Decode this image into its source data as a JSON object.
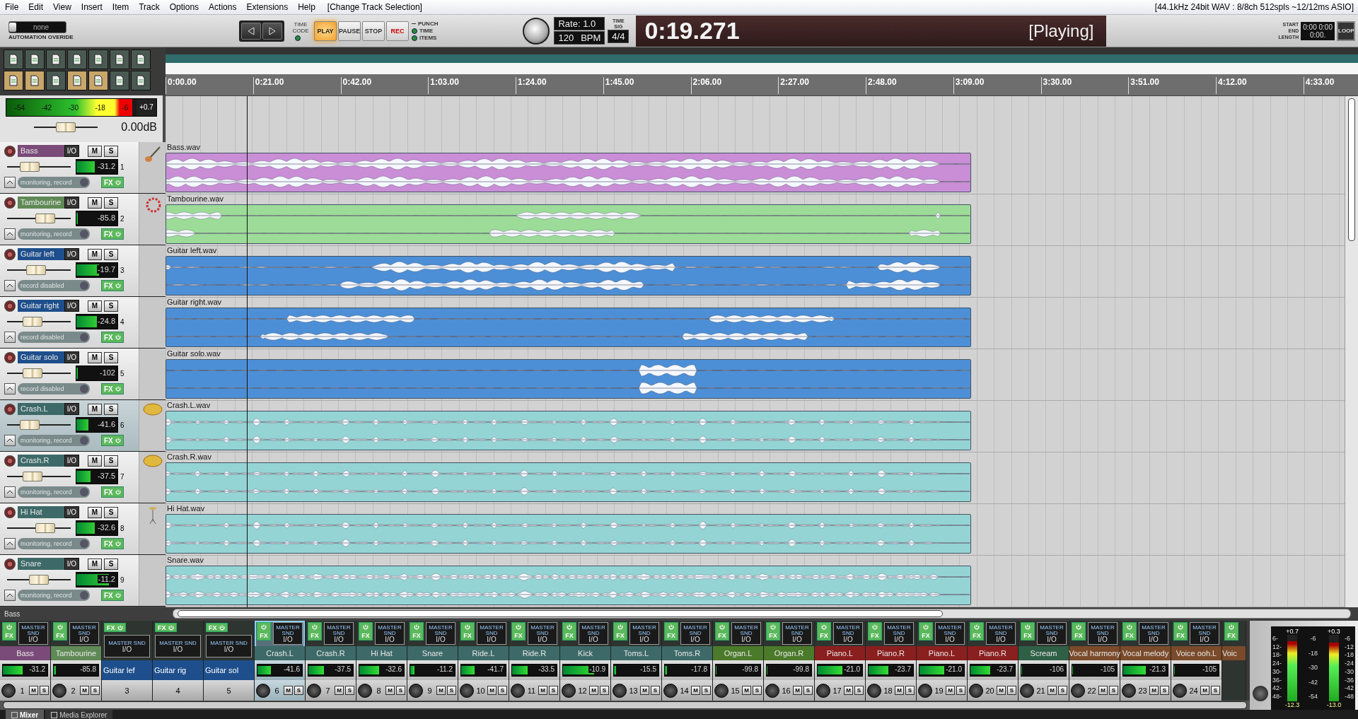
{
  "menu": [
    "File",
    "Edit",
    "View",
    "Insert",
    "Item",
    "Track",
    "Options",
    "Actions",
    "Extensions",
    "Help"
  ],
  "action_hint": "[Change Track Selection]",
  "audio_status": "[44.1kHz 24bit WAV : 8/8ch 512spls ~12/12ms ASIO]",
  "automation_override": {
    "value": "none",
    "label": "AUTOMATION OVERIDE"
  },
  "transport": {
    "time_code": "TIME CODE",
    "buttons": [
      {
        "label": "PLAY",
        "kind": "play",
        "selected": true
      },
      {
        "label": "PAUSE",
        "kind": "pause",
        "selected": false
      },
      {
        "label": "STOP",
        "kind": "stop",
        "selected": false
      },
      {
        "label": "REC",
        "kind": "record",
        "selected": false
      }
    ],
    "options": [
      {
        "label": "PUNCH",
        "kind": "bracket"
      },
      {
        "label": "TIME",
        "kind": "led"
      },
      {
        "label": "ITEMS",
        "kind": "led"
      }
    ]
  },
  "rate": "Rate: 1.0",
  "bpm": {
    "value": "120",
    "unit": "BPM"
  },
  "time_signature": {
    "label": "TIME SIG",
    "value": "4/4"
  },
  "clock": {
    "time": "0:19.271",
    "state": "[Playing]"
  },
  "loop": {
    "labels": [
      "START",
      "END",
      "LENGTH"
    ],
    "start": "0:00",
    "end": "0:00",
    "length": "0:00.",
    "button": "LOOP"
  },
  "toolbar": [
    {
      "on": false
    },
    {
      "on": false
    },
    {
      "on": false
    },
    {
      "on": false
    },
    {
      "on": false
    },
    {
      "on": false
    },
    {
      "on": false
    },
    {
      "on": true
    },
    {
      "on": true
    },
    {
      "on": false
    },
    {
      "on": true
    },
    {
      "on": true
    },
    {
      "on": false
    },
    {
      "on": false
    }
  ],
  "master_track": {
    "meter_scale": [
      "-54",
      "-42",
      "-30",
      "-18",
      "-6"
    ],
    "peak": "+0.7",
    "meter": {
      "level": 0.97
    },
    "fader": {
      "level": 0.5
    },
    "volume": "0.00dB"
  },
  "ruler": [
    "0:00.00",
    "0:21.00",
    "0:42.00",
    "1:03.00",
    "1:24.00",
    "1:45.00",
    "2:06.00",
    "2:27.00",
    "2:48.00",
    "3:09.00",
    "3:30.00",
    "3:51.00",
    "4:12.00",
    "4:33.00"
  ],
  "playhead": {
    "level": 0.068
  },
  "tracks": [
    {
      "name": "Bass",
      "color": "#7a4a78",
      "number": "1",
      "selected": false,
      "kind": "guitar",
      "io": "I/O",
      "mute": "M",
      "solo": "S",
      "fx": "FX",
      "fader": {
        "level": 0.35
      },
      "meter": {
        "level": 0.45,
        "reading": "-31.2"
      },
      "monitor": "monitoring, record",
      "item": {
        "file": "Bass.wav",
        "color": "#c98ed6"
      }
    },
    {
      "name": "Tambourine",
      "color": "#5f8a55",
      "number": "2",
      "selected": false,
      "kind": "tambourine",
      "io": "I/O",
      "mute": "M",
      "solo": "S",
      "fx": "FX",
      "fader": {
        "level": 0.6
      },
      "meter": {
        "level": 0.04,
        "reading": "-85.8"
      },
      "monitor": "monitoring, record",
      "item": {
        "file": "Tambourine.wav",
        "color": "#9cdc98"
      }
    },
    {
      "name": "Guitar left",
      "color": "#1e4f8c",
      "number": "3",
      "selected": false,
      "kind": "none",
      "io": "I/O",
      "mute": "M",
      "solo": "S",
      "fx": "FX",
      "fader": {
        "level": 0.45
      },
      "meter": {
        "level": 0.55,
        "reading": "-19.7"
      },
      "monitor": "record disabled",
      "item": {
        "file": "Guitar left.wav",
        "color": "#4d8fd6"
      }
    },
    {
      "name": "Guitar right",
      "color": "#1e4f8c",
      "number": "4",
      "selected": false,
      "kind": "none",
      "io": "I/O",
      "mute": "M",
      "solo": "S",
      "fx": "FX",
      "fader": {
        "level": 0.4
      },
      "meter": {
        "level": 0.5,
        "reading": "-24.8"
      },
      "monitor": "record disabled",
      "item": {
        "file": "Guitar right.wav",
        "color": "#4d8fd6"
      }
    },
    {
      "name": "Guitar solo",
      "color": "#1e4f8c",
      "number": "5",
      "selected": false,
      "kind": "none",
      "io": "I/O",
      "mute": "M",
      "solo": "S",
      "fx": "FX",
      "fader": {
        "level": 0.4
      },
      "meter": {
        "level": 0.03,
        "reading": "-102"
      },
      "monitor": "record disabled",
      "item": {
        "file": "Guitar solo.wav",
        "color": "#4d8fd6"
      }
    },
    {
      "name": "Crash.L",
      "color": "#3d6a68",
      "number": "6",
      "selected": true,
      "kind": "cymbal",
      "io": "I/O",
      "mute": "M",
      "solo": "S",
      "fx": "FX",
      "fader": {
        "level": 0.35
      },
      "meter": {
        "level": 0.3,
        "reading": "-41.6"
      },
      "monitor": "monitoring, record",
      "item": {
        "file": "Crash.L.wav",
        "color": "#95d4d4"
      }
    },
    {
      "name": "Crash.R",
      "color": "#3d6a68",
      "number": "7",
      "selected": false,
      "kind": "cymbal",
      "io": "I/O",
      "mute": "M",
      "solo": "S",
      "fx": "FX",
      "fader": {
        "level": 0.4
      },
      "meter": {
        "level": 0.35,
        "reading": "-37.5"
      },
      "monitor": "monitoring, record",
      "item": {
        "file": "Crash.R.wav",
        "color": "#95d4d4"
      }
    },
    {
      "name": "Hi Hat",
      "color": "#3d6a68",
      "number": "8",
      "selected": false,
      "kind": "hihat",
      "io": "I/O",
      "mute": "M",
      "solo": "S",
      "fx": "FX",
      "fader": {
        "level": 0.6
      },
      "meter": {
        "level": 0.45,
        "reading": "-32.6"
      },
      "monitor": "monitoring, record",
      "item": {
        "file": "Hi Hat.wav",
        "color": "#95d4d4"
      }
    },
    {
      "name": "Snare",
      "color": "#3d6a68",
      "number": "9",
      "selected": false,
      "kind": "none",
      "io": "I/O",
      "mute": "M",
      "solo": "S",
      "fx": "FX",
      "fader": {
        "level": 0.5
      },
      "meter": {
        "level": 0.8,
        "reading": "-11.2"
      },
      "monitor": "monitoring, record",
      "item": {
        "file": "Snare.wav",
        "color": "#95d4d4"
      }
    }
  ],
  "status": "Bass",
  "mixer": [
    {
      "kind": "normal",
      "name": "Bass",
      "color": "#7a4a78",
      "number": "1",
      "reading": "-31.2",
      "level": 0.45,
      "selected": false,
      "fx": "FX",
      "send": "MASTER SND",
      "io": "I/O",
      "mute": "M",
      "solo": "S"
    },
    {
      "kind": "normal",
      "name": "Tambourine",
      "color": "#5f8a55",
      "number": "2",
      "reading": "-85.8",
      "level": 0.04,
      "selected": false,
      "fx": "FX",
      "send": "MASTER SND",
      "io": "I/O",
      "mute": "M",
      "solo": "S"
    },
    {
      "kind": "compact",
      "name": "Guitar lef",
      "color": "#1e4f8c",
      "number": "3",
      "selected": false,
      "fx": "FX",
      "send": "MASTER SND",
      "io": "I/O"
    },
    {
      "kind": "compact",
      "name": "Guitar rig",
      "color": "#1e4f8c",
      "number": "4",
      "selected": false,
      "fx": "FX",
      "send": "MASTER SND",
      "io": "I/O"
    },
    {
      "kind": "compact",
      "name": "Guitar sol",
      "color": "#1e4f8c",
      "number": "5",
      "selected": false,
      "fx": "FX",
      "send": "MASTER SND",
      "io": "I/O"
    },
    {
      "kind": "normal",
      "name": "Crash.L",
      "color": "#3d6a68",
      "number": "6",
      "reading": "-41.6",
      "level": 0.3,
      "selected": true,
      "fx": "FX",
      "send": "MASTER SND",
      "io": "I/O",
      "mute": "M",
      "solo": "S"
    },
    {
      "kind": "normal",
      "name": "Crash.R",
      "color": "#3d6a68",
      "number": "7",
      "reading": "-37.5",
      "level": 0.35,
      "selected": false,
      "fx": "FX",
      "send": "MASTER SND",
      "io": "I/O",
      "mute": "M",
      "solo": "S"
    },
    {
      "kind": "normal",
      "name": "Hi Hat",
      "color": "#3d6a68",
      "number": "8",
      "reading": "-32.6",
      "level": 0.45,
      "selected": false,
      "fx": "FX",
      "send": "MASTER SND",
      "io": "I/O",
      "mute": "M",
      "solo": "S"
    },
    {
      "kind": "normal",
      "name": "Snare",
      "color": "#3d6a68",
      "number": "9",
      "reading": "-11.2",
      "level": 0.1,
      "selected": false,
      "fx": "FX",
      "send": "MASTER SND",
      "io": "I/O",
      "mute": "M",
      "solo": "S"
    },
    {
      "kind": "normal",
      "name": "Ride.L",
      "color": "#3d6a68",
      "number": "10",
      "reading": "-41.7",
      "level": 0.3,
      "selected": false,
      "fx": "FX",
      "send": "MASTER SND",
      "io": "I/O",
      "mute": "M",
      "solo": "S"
    },
    {
      "kind": "normal",
      "name": "Ride.R",
      "color": "#3d6a68",
      "number": "11",
      "reading": "-33.5",
      "level": 0.35,
      "selected": false,
      "fx": "FX",
      "send": "MASTER SND",
      "io": "I/O",
      "mute": "M",
      "solo": "S"
    },
    {
      "kind": "normal",
      "name": "Kick",
      "color": "#3d6a68",
      "number": "12",
      "reading": "-10.9",
      "level": 0.7,
      "selected": false,
      "fx": "FX",
      "send": "MASTER SND",
      "io": "I/O",
      "mute": "M",
      "solo": "S"
    },
    {
      "kind": "normal",
      "name": "Toms.L",
      "color": "#3d6a68",
      "number": "13",
      "reading": "-15.5",
      "level": 0.05,
      "selected": false,
      "fx": "FX",
      "send": "MASTER SND",
      "io": "I/O",
      "mute": "M",
      "solo": "S"
    },
    {
      "kind": "normal",
      "name": "Toms.R",
      "color": "#3d6a68",
      "number": "14",
      "reading": "-17.8",
      "level": 0.05,
      "selected": false,
      "fx": "FX",
      "send": "MASTER SND",
      "io": "I/O",
      "mute": "M",
      "solo": "S"
    },
    {
      "kind": "normal",
      "name": "Organ.L",
      "color": "#4a7a2a",
      "number": "15",
      "reading": "-99.8",
      "level": 0.02,
      "selected": false,
      "fx": "FX",
      "send": "MASTER SND",
      "io": "I/O",
      "mute": "M",
      "solo": "S"
    },
    {
      "kind": "normal",
      "name": "Organ.R",
      "color": "#4a7a2a",
      "number": "16",
      "reading": "-99.8",
      "level": 0.02,
      "selected": false,
      "fx": "FX",
      "send": "MASTER SND",
      "io": "I/O",
      "mute": "M",
      "solo": "S"
    },
    {
      "kind": "normal",
      "name": "Piano.L",
      "color": "#8a1f1f",
      "number": "17",
      "reading": "-21.0",
      "level": 0.55,
      "selected": false,
      "fx": "FX",
      "send": "MASTER SND",
      "io": "I/O",
      "mute": "M",
      "solo": "S"
    },
    {
      "kind": "normal",
      "name": "Piano.R",
      "color": "#8a1f1f",
      "number": "18",
      "reading": "-23.7",
      "level": 0.45,
      "selected": false,
      "fx": "FX",
      "send": "MASTER SND",
      "io": "I/O",
      "mute": "M",
      "solo": "S"
    },
    {
      "kind": "normal",
      "name": "Piano.L",
      "color": "#8a1f1f",
      "number": "19",
      "reading": "-21.0",
      "level": 0.55,
      "selected": false,
      "fx": "FX",
      "send": "MASTER SND",
      "io": "I/O",
      "mute": "M",
      "solo": "S"
    },
    {
      "kind": "normal",
      "name": "Piano.R",
      "color": "#8a1f1f",
      "number": "20",
      "reading": "-23.7",
      "level": 0.45,
      "selected": false,
      "fx": "FX",
      "send": "MASTER SND",
      "io": "I/O",
      "mute": "M",
      "solo": "S"
    },
    {
      "kind": "normal",
      "name": "Scream",
      "color": "#2f5f45",
      "number": "21",
      "reading": "-106",
      "level": 0.02,
      "selected": false,
      "fx": "FX",
      "send": "MASTER SND",
      "io": "I/O",
      "mute": "M",
      "solo": "S"
    },
    {
      "kind": "normal",
      "name": "Vocal harmony",
      "color": "#7a4a2a",
      "number": "22",
      "reading": "-105",
      "level": 0.02,
      "selected": false,
      "fx": "FX",
      "send": "MASTER SND",
      "io": "I/O",
      "mute": "M",
      "solo": "S"
    },
    {
      "kind": "normal",
      "name": "Vocal melody",
      "color": "#7a4a2a",
      "number": "23",
      "reading": "-21.3",
      "level": 0.5,
      "selected": false,
      "fx": "FX",
      "send": "MASTER SND",
      "io": "I/O",
      "mute": "M",
      "solo": "S"
    },
    {
      "kind": "normal",
      "name": "Voice ooh.L",
      "color": "#7a4a2a",
      "number": "24",
      "reading": "-105",
      "level": 0.02,
      "selected": false,
      "fx": "FX",
      "send": "MASTER SND",
      "io": "I/O",
      "mute": "M",
      "solo": "S"
    },
    {
      "kind": "partial",
      "name": "Voic",
      "color": "#7a4a2a",
      "selected": false,
      "fx": "FX"
    }
  ],
  "mixer_master": {
    "peak_left": "+0.7",
    "peak_right": "+0.3",
    "left_scale": [
      "6-",
      "12-",
      "18-",
      "24-",
      "30-",
      "36-",
      "42-",
      "48-"
    ],
    "center_scale": [
      "-6",
      "-18",
      "-30",
      "-42",
      "-54"
    ],
    "right_scale": [
      "-6",
      "-12",
      "-18",
      "-24",
      "-30",
      "-36",
      "-42",
      "-48"
    ],
    "meter_left": {
      "level": 0.9,
      "reading": "-12.3"
    },
    "meter_right": {
      "level": 0.88,
      "reading": "-13.0"
    }
  },
  "tabs": [
    {
      "label": "Mixer",
      "selected": true
    },
    {
      "label": "Media Explorer",
      "selected": false
    }
  ]
}
